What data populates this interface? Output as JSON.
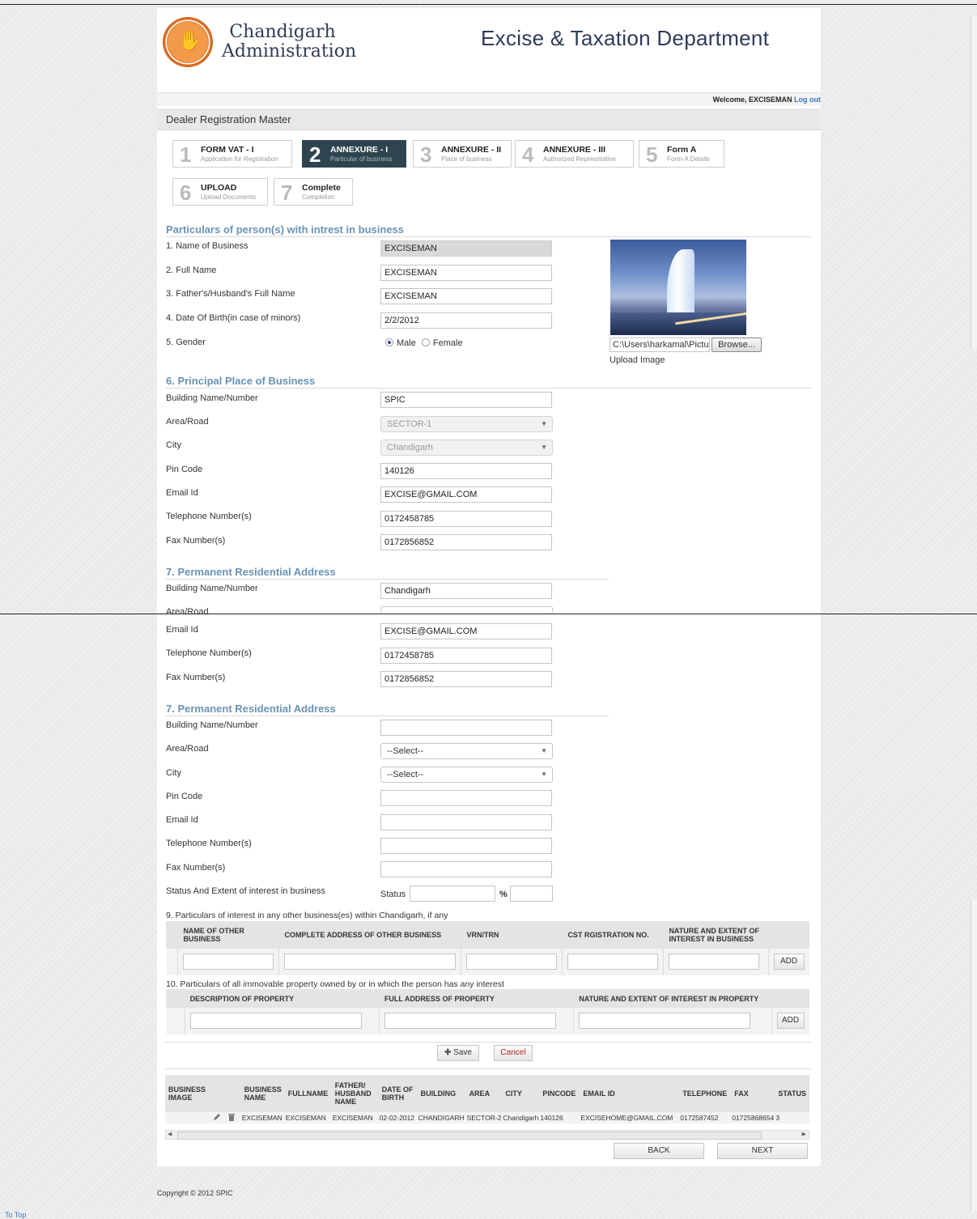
{
  "header": {
    "org_name_line1": "Chandigarh",
    "org_name_line2": "Administration",
    "department": "Excise & Taxation Department",
    "welcome": "Welcome, EXCISEMAN",
    "logout": "Log out"
  },
  "page_title": "Dealer Registration Master",
  "steps": [
    {
      "num": "1",
      "title": "FORM VAT - I",
      "sub": "Application for Registration"
    },
    {
      "num": "2",
      "title": "ANNEXURE - I",
      "sub": "Particular of business"
    },
    {
      "num": "3",
      "title": "ANNEXURE - II",
      "sub": "Place of business"
    },
    {
      "num": "4",
      "title": "ANNEXURE - III",
      "sub": "Authorized Represntative"
    },
    {
      "num": "5",
      "title": "Form A",
      "sub": "Form-A Details"
    },
    {
      "num": "6",
      "title": "UPLOAD",
      "sub": "Upload Documents"
    },
    {
      "num": "7",
      "title": "Complete",
      "sub": "Completion"
    }
  ],
  "particulars": {
    "title": "Particulars of person(s) with intrest in business",
    "name_of_business_label": "1. Name of Business",
    "name_of_business": "EXCISEMAN",
    "full_name_label": "2. Full Name",
    "full_name": "EXCISEMAN",
    "father_label": "3. Father's/Husband's Full Name",
    "father": "EXCISEMAN",
    "dob_label": "4. Date Of Birth(in case of minors)",
    "dob": "2/2/2012",
    "gender_label": "5. Gender",
    "male": "Male",
    "female": "Female",
    "file_path": "C:\\Users\\harkamal\\Pictu",
    "browse": "Browse...",
    "upload_image": "Upload Image"
  },
  "principal": {
    "title": "6. Principal Place of Business",
    "building_label": "Building Name/Number",
    "building": "SPIC",
    "area_label": "Area/Road",
    "area": "SECTOR-1",
    "city_label": "City",
    "city": "Chandigarh",
    "pin_label": "Pin Code",
    "pin": "140126",
    "email_label": "Email Id",
    "email": "EXCISE@GMAIL.COM",
    "tel_label": "Telephone Number(s)",
    "tel": "0172458785",
    "fax_label": "Fax Number(s)",
    "fax": "0172856852"
  },
  "permanent_top": {
    "title": "7. Permanent Residential Address",
    "building_label": "Building Name/Number",
    "building": "Chandigarh",
    "area_label": "Area/Road"
  },
  "lower": {
    "email_label": "Email Id",
    "email": "EXCISE@GMAIL.COM",
    "tel_label": "Telephone Number(s)",
    "tel": "0172458785",
    "fax_label": "Fax Number(s)",
    "fax": "0172856852"
  },
  "permanent": {
    "title": "7. Permanent Residential Address",
    "building_label": "Building Name/Number",
    "area_label": "Area/Road",
    "area": "--Select--",
    "city_label": "City",
    "city": "--Select--",
    "pin_label": "Pin Code",
    "email_label": "Email Id",
    "tel_label": "Telephone Number(s)",
    "fax_label": "Fax Number(s)",
    "status_label": "Status And Extent of interest in business",
    "status_word": "Status",
    "percent": "%"
  },
  "other_business": {
    "title": "9. Particulars of interest in any other business(es) within Chandigarh, if any",
    "headers": [
      "NAME OF OTHER BUSINESS",
      "COMPLETE ADDRESS OF OTHER BUSINESS",
      "VRN/TRN",
      "CST RGISTRATION NO.",
      "NATURE AND EXTENT OF INTEREST IN BUSINESS"
    ],
    "add": "ADD"
  },
  "property": {
    "title": "10. Particulars of all immovable property owned by or in which the person has any interest",
    "headers": [
      "DESCRIPTION OF PROPERTY",
      "FULL ADDRESS OF PROPERTY",
      "NATURE AND EXTENT OF INTEREST IN PROPERTY"
    ],
    "add": "ADD"
  },
  "actions": {
    "save": "Save",
    "cancel": "Cancel",
    "back": "BACK",
    "next": "NEXT"
  },
  "results": {
    "headers": [
      "BUSINESS IMAGE",
      "",
      "",
      "BUSINESS NAME",
      "FULLNAME",
      "FATHER/ HUSBAND NAME",
      "DATE OF BIRTH",
      "BUILDING",
      "AREA",
      "CITY",
      "PINCODE",
      "EMAIL ID",
      "TELEPHONE",
      "FAX",
      "STATUS"
    ],
    "row": {
      "business_name": "EXCISEMAN",
      "fullname": "EXCISEMAN",
      "father": "EXCISEMAN",
      "dob": "02-02-2012",
      "building": "CHANDIGARH",
      "area": "SECTOR-2",
      "city": "Chandigarh",
      "pincode": "140126",
      "email": "EXCISEHOME@GMAIL.COM",
      "telephone": "0172587452",
      "fax": "01725868654",
      "status": "3"
    }
  },
  "footer": {
    "copyright": "Copyright © 2012 SPIC",
    "to_top": "To Top"
  }
}
